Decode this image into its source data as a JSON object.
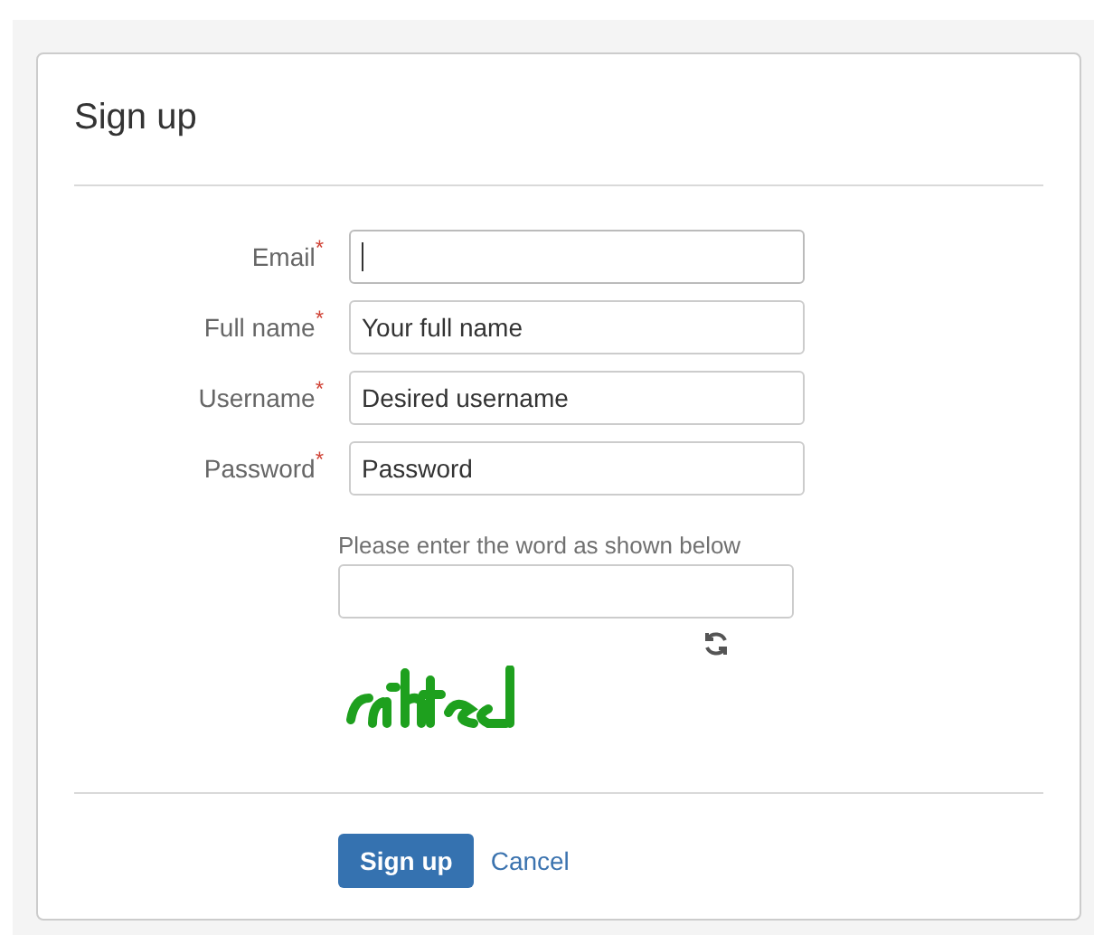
{
  "title": "Sign up",
  "fields": [
    {
      "label": "Email",
      "required_mark": "*",
      "focused": true
    },
    {
      "label": "Full name",
      "required_mark": "*",
      "placeholder": "Your full name",
      "focused": false
    },
    {
      "label": "Username",
      "required_mark": "*",
      "placeholder": "Desired username",
      "focused": false
    },
    {
      "label": "Password",
      "required_mark": "*",
      "placeholder": "Password",
      "focused": false
    }
  ],
  "captcha": {
    "prompt": "Please enter the word as shown below"
  },
  "buttons": {
    "submit": "Sign up",
    "cancel": "Cancel"
  }
}
